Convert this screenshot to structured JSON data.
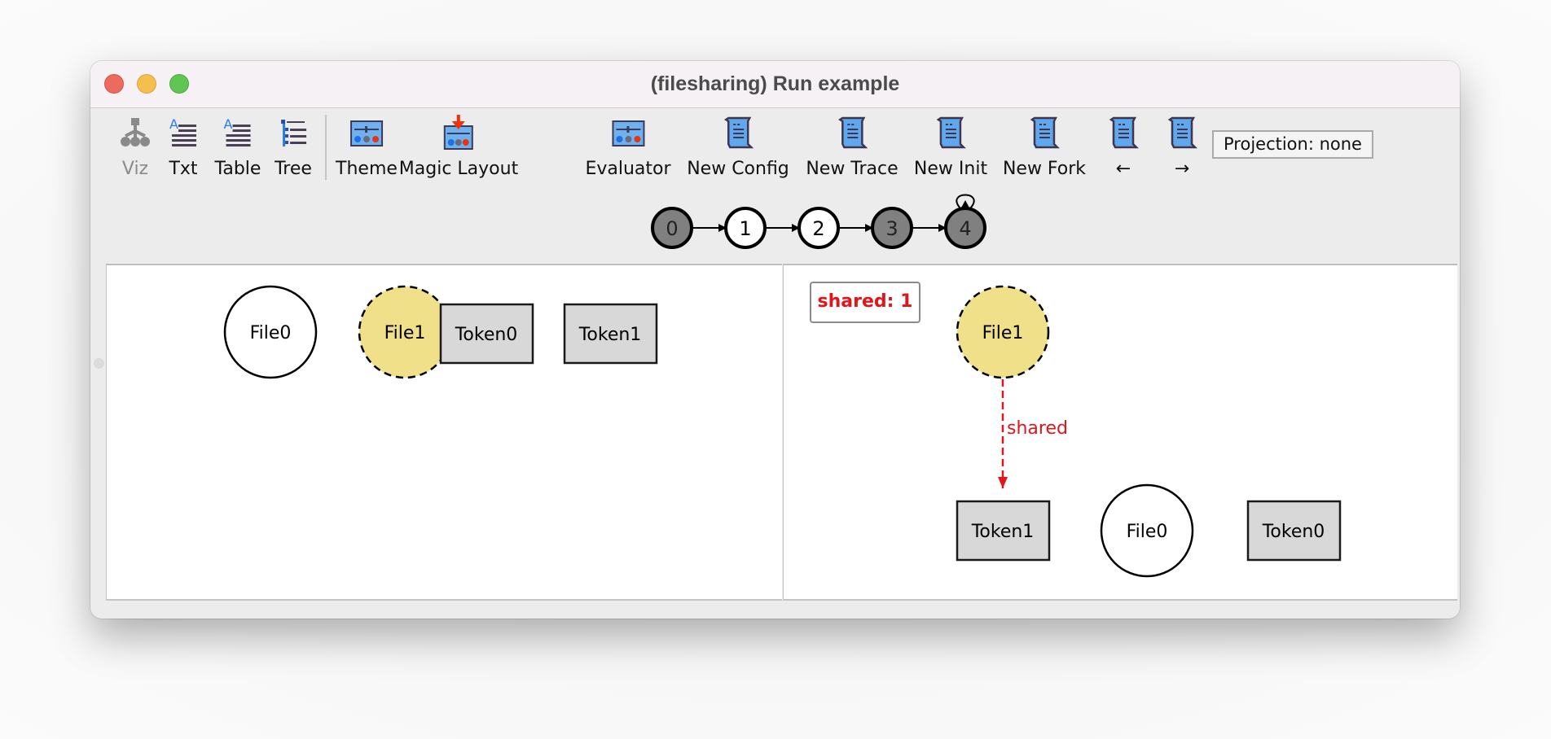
{
  "window": {
    "title": "(filesharing) Run example",
    "traffic_lights": [
      "close",
      "minimize",
      "zoom"
    ]
  },
  "toolbar": {
    "items": [
      {
        "label": "Viz",
        "icon": "viz-tree-icon",
        "enabled": false
      },
      {
        "label": "Txt",
        "icon": "text-icon",
        "enabled": true
      },
      {
        "label": "Table",
        "icon": "table-icon",
        "enabled": true
      },
      {
        "label": "Tree",
        "icon": "tree-icon",
        "enabled": true
      },
      {
        "label": "Theme",
        "icon": "theme-icon",
        "enabled": true
      },
      {
        "label": "Magic Layout",
        "icon": "magic-layout-icon",
        "enabled": true
      },
      {
        "label": "Evaluator",
        "icon": "evaluator-icon",
        "enabled": true
      },
      {
        "label": "New Config",
        "icon": "scroll-icon",
        "enabled": true
      },
      {
        "label": "New Trace",
        "icon": "scroll-icon",
        "enabled": true
      },
      {
        "label": "New Init",
        "icon": "scroll-icon",
        "enabled": true
      },
      {
        "label": "New Fork",
        "icon": "scroll-icon",
        "enabled": true
      },
      {
        "label": "←",
        "icon": "scroll-icon",
        "enabled": true
      },
      {
        "label": "→",
        "icon": "scroll-icon",
        "enabled": true
      }
    ],
    "projection_label": "Projection: none"
  },
  "trace": {
    "states": [
      {
        "label": "0",
        "filled": true
      },
      {
        "label": "1",
        "filled": false
      },
      {
        "label": "2",
        "filled": false
      },
      {
        "label": "3",
        "filled": true
      },
      {
        "label": "4",
        "filled": true,
        "self_loop": true
      }
    ],
    "colors": {
      "filled": "#808080",
      "empty": "#ffffff"
    }
  },
  "left_panel": {
    "nodes": [
      {
        "label": "File0",
        "shape": "circle",
        "style": "solid",
        "fill": "#ffffff"
      },
      {
        "label": "File1",
        "shape": "circle",
        "style": "dashed",
        "fill": "#efe089"
      },
      {
        "label": "Token0",
        "shape": "box",
        "style": "solid",
        "fill": "#d8d8d8"
      },
      {
        "label": "Token1",
        "shape": "box",
        "style": "solid",
        "fill": "#d8d8d8"
      }
    ]
  },
  "right_panel": {
    "skolem_label": "shared: 1",
    "nodes": [
      {
        "label": "File1",
        "shape": "circle",
        "style": "dashed",
        "fill": "#efe089"
      },
      {
        "label": "Token1",
        "shape": "box",
        "style": "solid",
        "fill": "#d8d8d8"
      },
      {
        "label": "File0",
        "shape": "circle",
        "style": "solid",
        "fill": "#ffffff"
      },
      {
        "label": "Token0",
        "shape": "box",
        "style": "solid",
        "fill": "#d8d8d8"
      }
    ],
    "edges": [
      {
        "from": "File1",
        "to": "Token1",
        "label": "shared",
        "color": "#e0161b",
        "style": "dashed"
      }
    ]
  }
}
